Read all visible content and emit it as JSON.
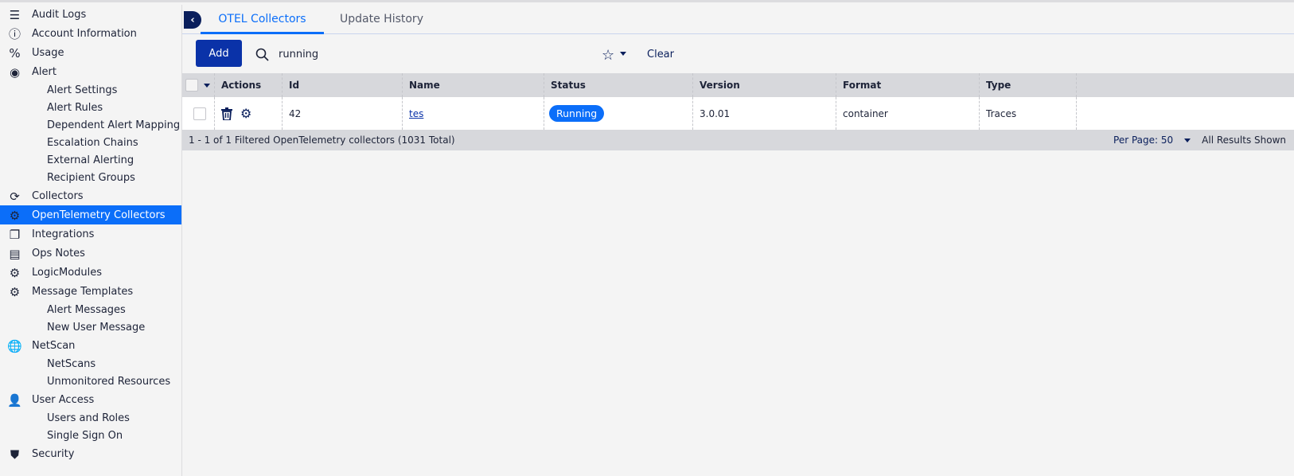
{
  "sidebar": {
    "items": [
      {
        "label": "Audit Logs",
        "icon": "list-icon",
        "glyph": "☰",
        "sub": false
      },
      {
        "label": "Account Information",
        "icon": "info-circle-icon",
        "glyph": "ⓘ",
        "sub": false
      },
      {
        "label": "Usage",
        "icon": "usage-percent-icon",
        "glyph": "%",
        "sub": false
      },
      {
        "label": "Alert",
        "icon": "alert-icon",
        "glyph": "◉",
        "sub": false
      },
      {
        "label": "Alert Settings",
        "sub": true
      },
      {
        "label": "Alert Rules",
        "sub": true
      },
      {
        "label": "Dependent Alert Mapping",
        "sub": true
      },
      {
        "label": "Escalation Chains",
        "sub": true
      },
      {
        "label": "External Alerting",
        "sub": true
      },
      {
        "label": "Recipient Groups",
        "sub": true
      },
      {
        "label": "Collectors",
        "icon": "collector-icon",
        "glyph": "⟳",
        "sub": false
      },
      {
        "label": "OpenTelemetry Collectors",
        "icon": "gear-icon",
        "glyph": "⚙",
        "sub": false,
        "active": true
      },
      {
        "label": "Integrations",
        "icon": "integrations-icon",
        "glyph": "❐",
        "sub": false
      },
      {
        "label": "Ops Notes",
        "icon": "notes-icon",
        "glyph": "▤",
        "sub": false
      },
      {
        "label": "LogicModules",
        "icon": "gear-icon",
        "glyph": "⚙",
        "sub": false
      },
      {
        "label": "Message Templates",
        "icon": "gear-icon",
        "glyph": "⚙",
        "sub": false
      },
      {
        "label": "Alert Messages",
        "sub": true
      },
      {
        "label": "New User Message",
        "sub": true
      },
      {
        "label": "NetScan",
        "icon": "globe-search-icon",
        "glyph": "🌐",
        "sub": false
      },
      {
        "label": "NetScans",
        "sub": true
      },
      {
        "label": "Unmonitored Resources",
        "sub": true
      },
      {
        "label": "User Access",
        "icon": "user-lock-icon",
        "glyph": "👤",
        "sub": false
      },
      {
        "label": "Users and Roles",
        "sub": true
      },
      {
        "label": "Single Sign On",
        "sub": true
      },
      {
        "label": "Security",
        "icon": "shield-icon",
        "glyph": "⛊",
        "sub": false
      }
    ]
  },
  "tabs": [
    {
      "label": "OTEL Collectors",
      "active": true
    },
    {
      "label": "Update History",
      "active": false
    }
  ],
  "toolbar": {
    "add_label": "Add",
    "search_value": "running",
    "clear_label": "Clear"
  },
  "table": {
    "columns": [
      "Actions",
      "Id",
      "Name",
      "Status",
      "Version",
      "Format",
      "Type"
    ],
    "rows": [
      {
        "id": "42",
        "name": "tes",
        "status": "Running",
        "version": "3.0.01",
        "format": "container",
        "type": "Traces"
      }
    ],
    "summary": "1 - 1 of 1 Filtered OpenTelemetry collectors (1031 Total)",
    "per_page": "Per Page: 50",
    "results": "All Results Shown"
  },
  "colors": {
    "accent": "#0b6ef9",
    "primary_button": "#0a32a8",
    "navy": "#0a1f5c"
  }
}
